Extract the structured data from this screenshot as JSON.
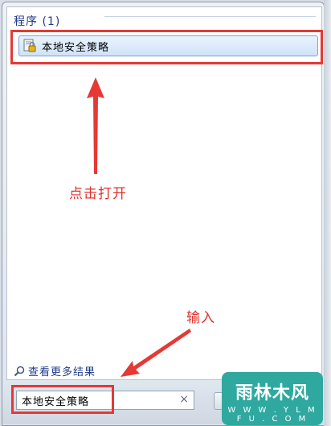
{
  "start_menu": {
    "section_header": "程序 (1)",
    "program_item": {
      "label": "本地安全策略",
      "icon": "security-policy-icon"
    },
    "see_more": {
      "label": "查看更多结果",
      "icon": "search-icon"
    },
    "search": {
      "value": "本地安全策略",
      "clear_label": "×"
    }
  },
  "annotations": {
    "click_open": "点击打开",
    "input": "输入",
    "color": "#e53935"
  },
  "watermark": {
    "title": "雨林木风",
    "url": "W W W . Y L M F U . C O M"
  }
}
